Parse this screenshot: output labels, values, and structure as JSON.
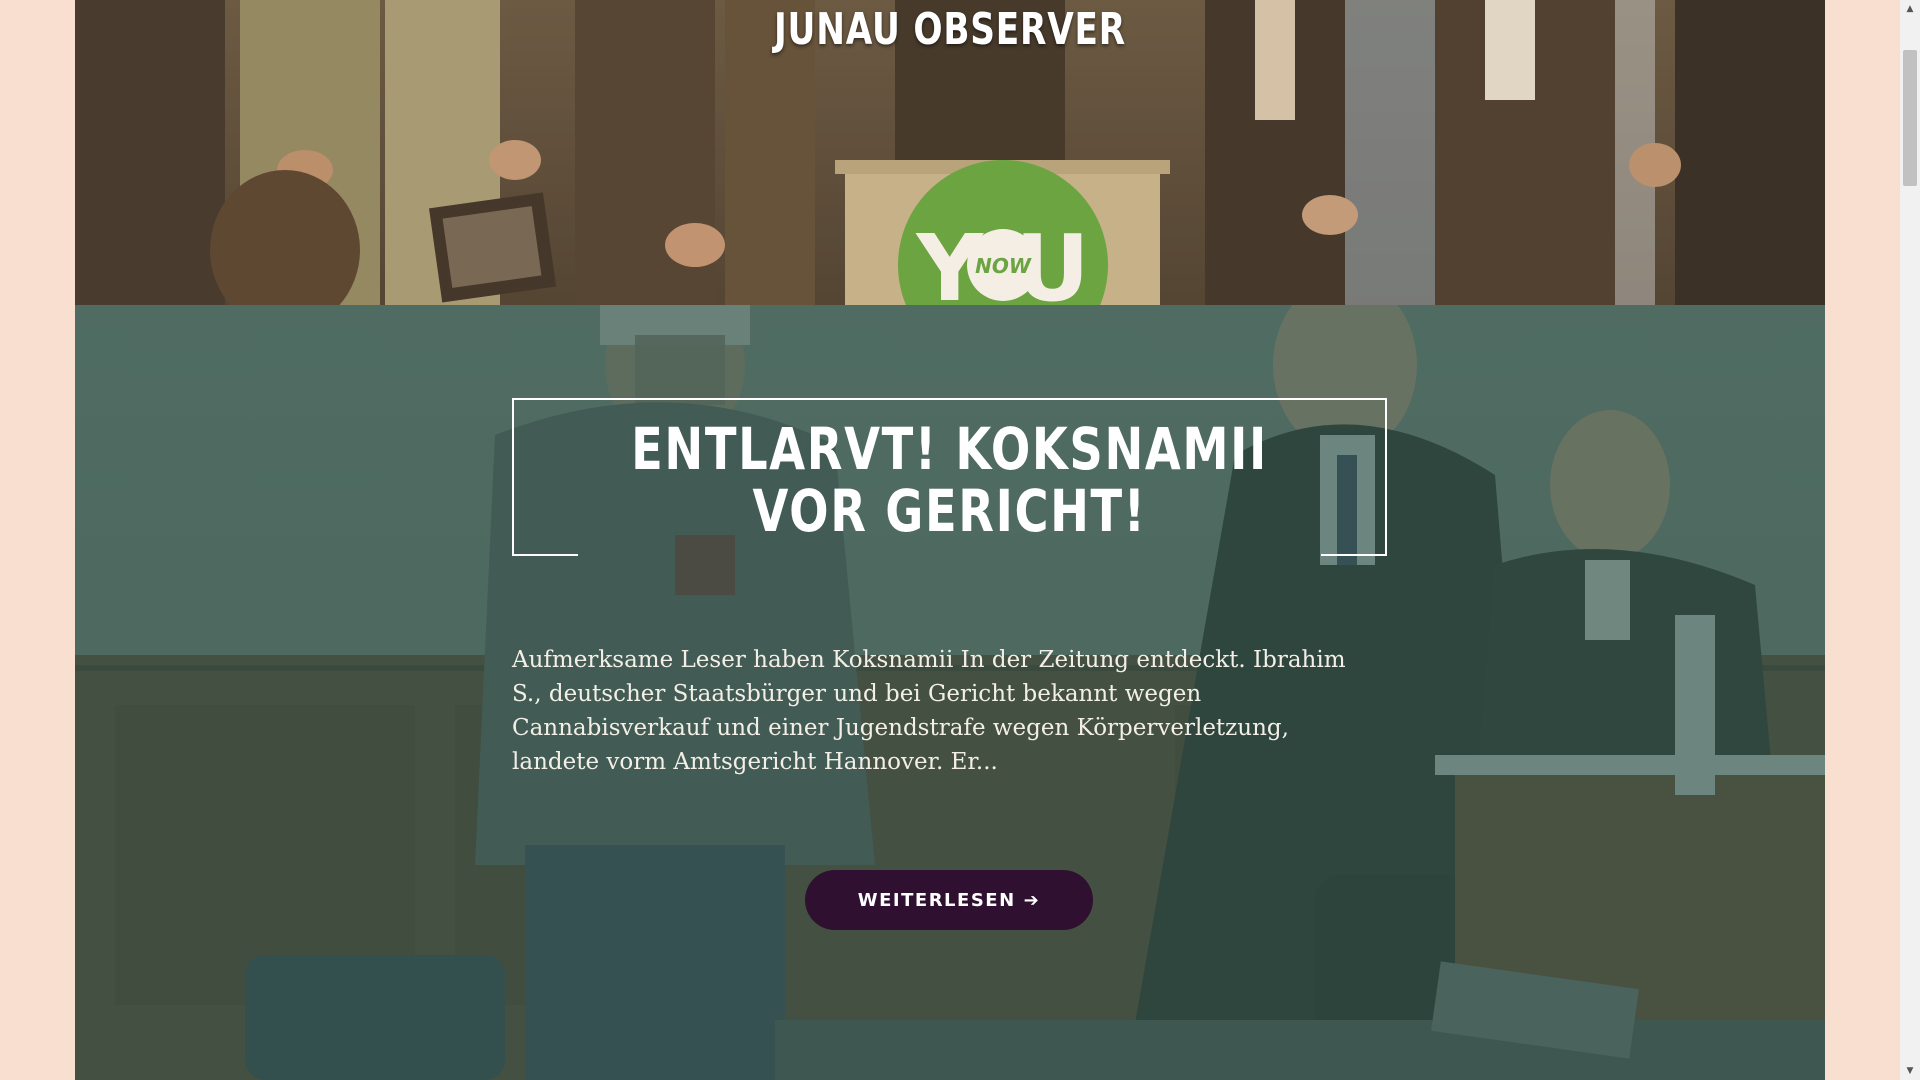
{
  "site": {
    "title": "JUNAU OBSERVER",
    "header_photo_desc": "Foto: Pressekonferenz am Rednerpult mit YOU-now-Logo"
  },
  "article": {
    "title": "ENTLARVT! KOKSNAMII\nVOR GERICHT!",
    "excerpt": "Aufmerksame Leser haben Koksnamii In der Zeitung entdeckt.  Ibrahim S., deutscher Staatsbürger und bei Gericht bekannt wegen Cannabisverkauf und einer Jugendstrafe wegen Körperverletzung, landete vorm Amtsgericht Hannover. Er...",
    "read_more_label": "WEITERLESEN",
    "read_more_icon": "arrow-right-icon"
  },
  "podium_logo": {
    "big": "Y U",
    "small": "NOW"
  },
  "colors": {
    "page_background": "#f8dfcf",
    "hero_overlay": "#3a5c50",
    "button": "#2f1030",
    "text": "#ffffff"
  }
}
